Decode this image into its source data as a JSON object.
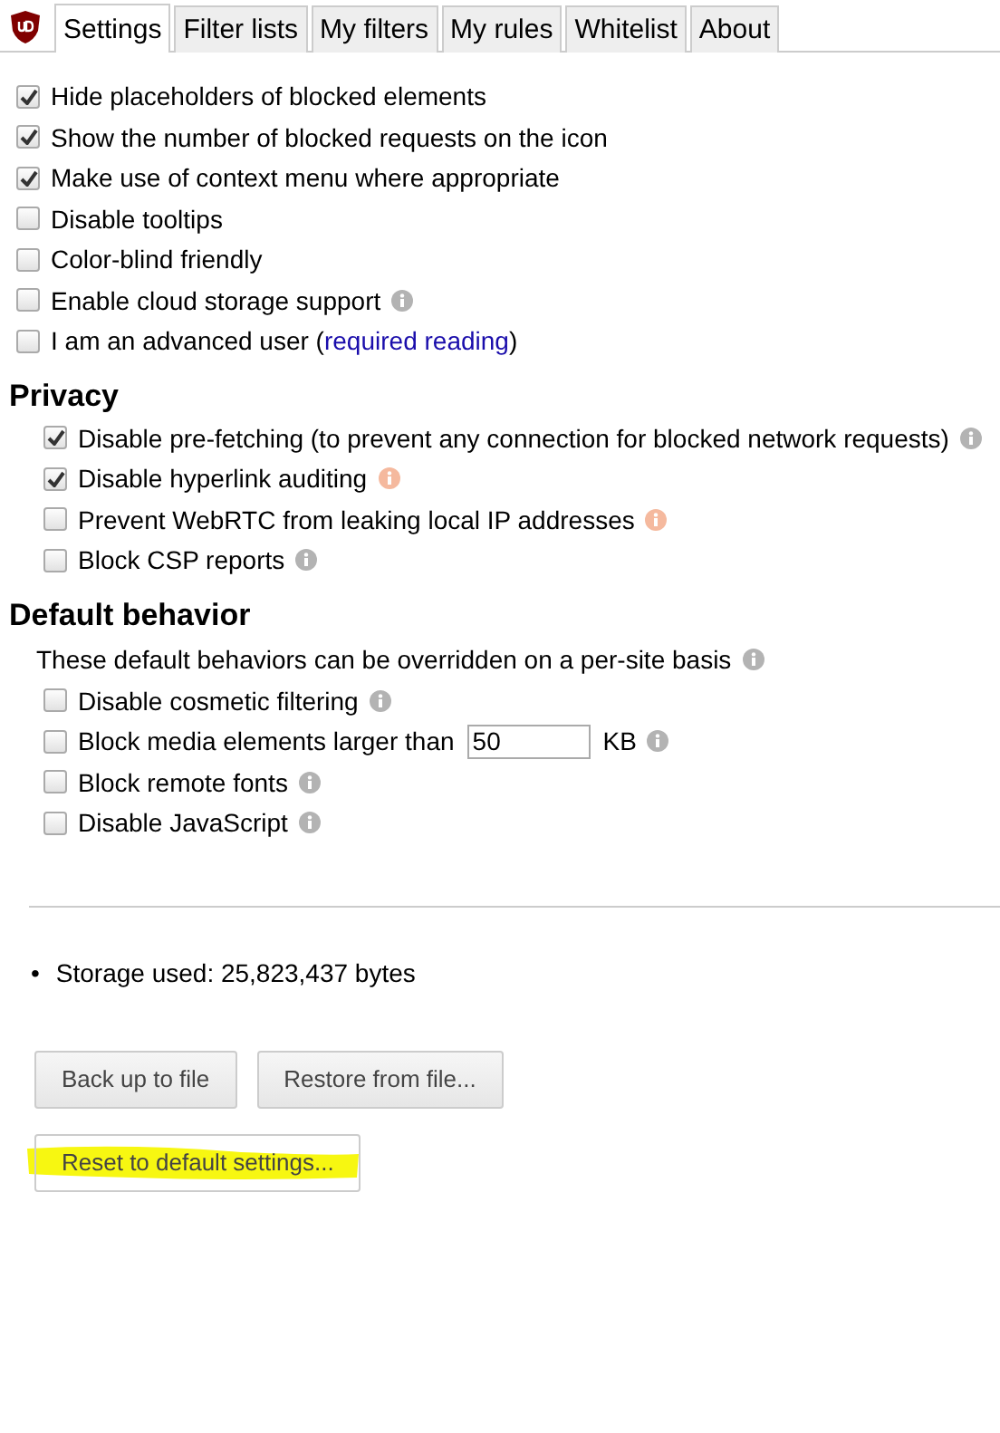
{
  "tabs": [
    {
      "label": "Settings",
      "selected": true
    },
    {
      "label": "Filter lists",
      "selected": false
    },
    {
      "label": "My filters",
      "selected": false
    },
    {
      "label": "My rules",
      "selected": false
    },
    {
      "label": "Whitelist",
      "selected": false
    },
    {
      "label": "About",
      "selected": false
    }
  ],
  "general": [
    {
      "kind": "checkbox",
      "label": "Hide placeholders of blocked elements",
      "checked": true
    },
    {
      "kind": "checkbox",
      "label": "Show the number of blocked requests on the icon",
      "checked": true
    },
    {
      "kind": "checkbox",
      "label": "Make use of context menu where appropriate",
      "checked": true
    },
    {
      "kind": "checkbox",
      "label": "Disable tooltips",
      "checked": false
    },
    {
      "kind": "checkbox",
      "label": "Color-blind friendly",
      "checked": false
    },
    {
      "kind": "checkbox",
      "label": "Enable cloud storage support",
      "checked": false,
      "info": {
        "color": "#b3b3b3"
      }
    },
    {
      "kind": "checkbox",
      "label": "I am an advanced user (",
      "link": "required reading",
      "suffix": ")",
      "checked": false
    }
  ],
  "sections": [
    {
      "title": "Privacy",
      "items": [
        {
          "kind": "checkbox",
          "label": "Disable pre-fetching (to prevent any connection for blocked network requests)",
          "checked": true,
          "info": {
            "color": "#b3b3b3"
          }
        },
        {
          "kind": "checkbox",
          "label": "Disable hyperlink auditing",
          "checked": true,
          "info": {
            "color": "#f5b99e"
          }
        },
        {
          "kind": "checkbox",
          "label": "Prevent WebRTC from leaking local IP addresses",
          "checked": false,
          "info": {
            "color": "#f5b99e"
          }
        },
        {
          "kind": "checkbox",
          "label": "Block CSP reports",
          "checked": false,
          "info": {
            "color": "#b3b3b3"
          }
        }
      ]
    },
    {
      "title": "Default behavior",
      "note": "These default behaviors can be overridden on a per-site basis",
      "note_info": {
        "color": "#b3b3b3"
      },
      "items": [
        {
          "kind": "checkbox",
          "label": "Disable cosmetic filtering",
          "checked": false,
          "info": {
            "color": "#b3b3b3"
          }
        },
        {
          "kind": "size",
          "label": "Block media elements larger than",
          "value": "50",
          "unit": "KB",
          "checked": false,
          "info": {
            "color": "#b3b3b3"
          }
        },
        {
          "kind": "checkbox",
          "label": "Block remote fonts",
          "checked": false,
          "info": {
            "color": "#b3b3b3"
          }
        },
        {
          "kind": "checkbox",
          "label": "Disable JavaScript",
          "checked": false,
          "info": {
            "color": "#b3b3b3"
          }
        }
      ]
    }
  ],
  "storage": {
    "bullet": "•",
    "text": "Storage used: 25,823,437 bytes"
  },
  "button_rows": [
    [
      {
        "label": "Back up to file",
        "highlighted": false
      },
      {
        "label": "Restore from file...",
        "highlighted": false
      }
    ],
    [
      {
        "label": "Reset to default settings...",
        "highlighted": true
      }
    ]
  ]
}
